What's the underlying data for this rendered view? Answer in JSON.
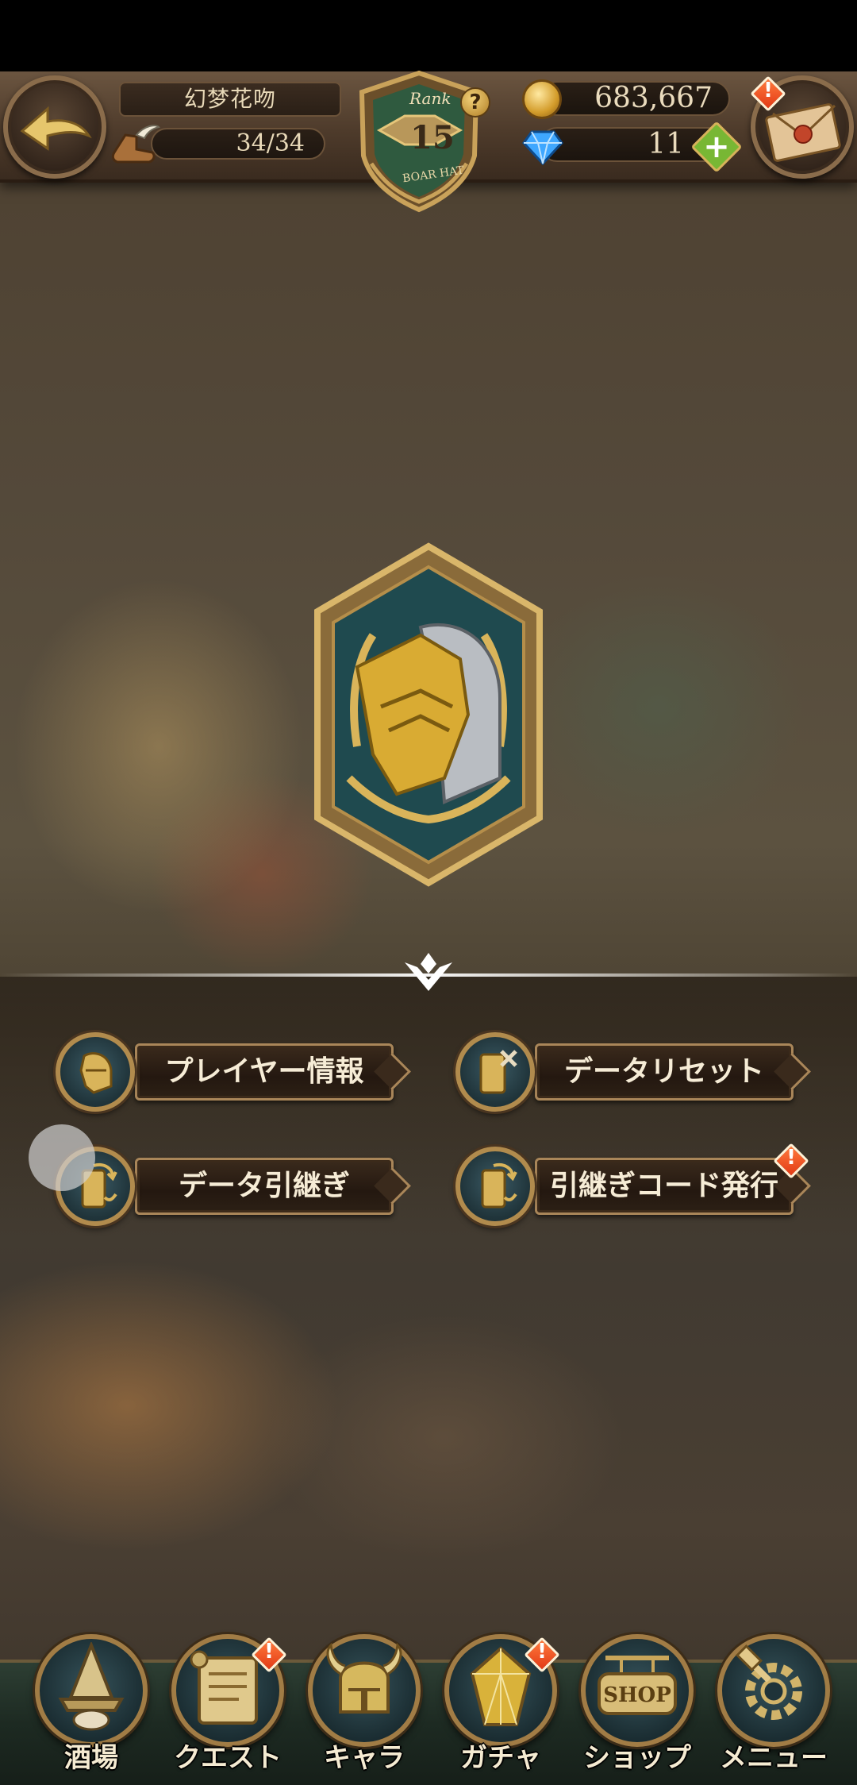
{
  "header": {
    "player_name": "幻梦花吻",
    "stamina": "34/34",
    "rank_label": "Rank",
    "rank_value": "15",
    "rank_title": "BOAR HAT",
    "help_glyph": "?",
    "coins": "683,667",
    "gems": "11",
    "plus_glyph": "+",
    "alert_glyph": "!"
  },
  "menu": {
    "player_info": "プレイヤー情報",
    "data_reset": "データリセット",
    "data_transfer": "データ引継ぎ",
    "transfer_code": "引継ぎコード発行"
  },
  "nav": [
    {
      "label": "酒場"
    },
    {
      "label": "クエスト"
    },
    {
      "label": "キャラ"
    },
    {
      "label": "ガチャ"
    },
    {
      "label": "ショップ",
      "icon_text": "SHOP"
    },
    {
      "label": "メニュー"
    }
  ],
  "colors": {
    "accent_gold": "#b18b4d",
    "alert_orange": "#e23a16",
    "gem_blue": "#3fa7ff",
    "plus_green": "#78b734"
  },
  "icons": {
    "back": "back-arrow-icon",
    "mail": "mail-envelope-icon",
    "stamina": "winged-boot-icon",
    "coin": "gold-coin-icon",
    "gem": "blue-gem-icon",
    "emblem": "golden-knight-helmet-emblem"
  }
}
